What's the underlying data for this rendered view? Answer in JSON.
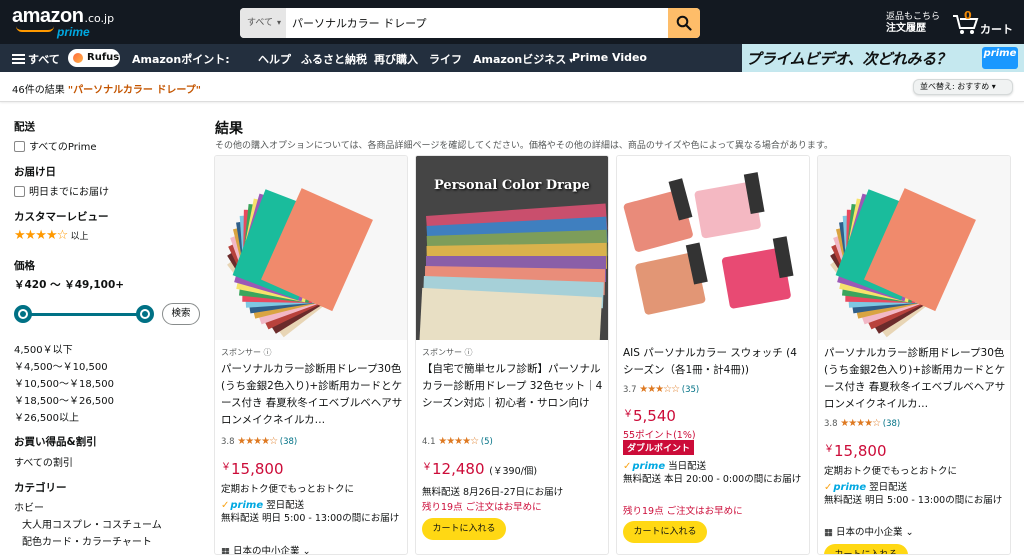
{
  "header": {
    "logo_text": "amazon",
    "logo_tld": ".co.jp",
    "logo_prime": "prime",
    "search_category": "すべて",
    "search_value": "パーソナルカラー ドレープ",
    "orders_line1": "返品もこちら",
    "orders_line2": "注文履歴",
    "cart_count": "0",
    "cart_label": "カート"
  },
  "nav": {
    "all": "すべて",
    "rufus": "Rufus",
    "items": [
      "Amazonポイント:",
      "ヘルプ",
      "ふるさと納税",
      "再び購入",
      "ライフ",
      "Amazonビジネス",
      "Prime Video"
    ],
    "promo_text": "プライムビデオ、次どれみる？",
    "promo_badge": "prime"
  },
  "results": {
    "count_text": "46件の結果",
    "query_text": "\"パーソナルカラー ドレープ\"",
    "sort_label": "並べ替え: おすすめ"
  },
  "sidebar": {
    "delivery_heading": "配送",
    "all_prime": "すべてのPrime",
    "delivery_date_heading": "お届け日",
    "tomorrow": "明日までにお届け",
    "review_heading": "カスタマーレビュー",
    "review_stars": "★★★★☆",
    "review_suffix": "以上",
    "price_heading": "価格",
    "price_range": "￥420 〜 ￥49,100+",
    "search_button": "検索",
    "price_options": [
      "4,500￥以下",
      "￥4,500〜￥10,500",
      "￥10,500〜￥18,500",
      "￥18,500〜￥26,500",
      "￥26,500以上"
    ],
    "deals_heading": "お買い得品&割引",
    "all_discounts": "すべての割引",
    "category_heading": "カテゴリー",
    "categories": [
      "ホビー",
      "大人用コスプレ・コスチューム",
      "配色カード・カラーチャート"
    ]
  },
  "main": {
    "title": "結果",
    "subtitle": "その他の購入オプションについては、各商品詳細ページを確認してください。価格やその他の詳細は、商品のサイズや色によって異なる場合があります。"
  },
  "products": [
    {
      "sponsored": "スポンサー ⓘ",
      "name": "パーソナルカラー診断用ドレープ30色(うち金銀2色入り)+診断用カードとケース付き 春夏秋冬イエベブルベヘアサロンメイクネイルカ…",
      "rating": "3.8",
      "stars": "★★★★☆",
      "reviews": "(38)",
      "price": "15,800",
      "sub_note": "定期おトク便でもっとおトクに",
      "prime_note": "翌日配送",
      "delivery": "無料配送 明日 5:00 - 13:00の間にお届け",
      "seller": "日本の中小企業"
    },
    {
      "sponsored": "スポンサー ⓘ",
      "name": "【自宅で簡単セルフ診断】パーソナルカラー診断用ドレープ 32色セット｜4シーズン対応｜初心者・サロン向け",
      "image_title": "Personal Color Drape",
      "rating": "4.1",
      "stars": "★★★★☆",
      "reviews": "(5)",
      "price": "12,480",
      "unit_price": "(￥390/個)",
      "delivery": "無料配送 8月26日-27日にお届け",
      "stock": "残り19点 ご注文はお早めに",
      "button": "カートに入れる"
    },
    {
      "name": "AIS パーソナルカラー スウォッチ (4シーズン（各1冊・計4冊))",
      "rating": "3.7",
      "stars": "★★★☆☆",
      "reviews": "(35)",
      "price": "5,540",
      "points": "55ポイント(1%)",
      "badge": "ダブルポイント",
      "prime_note": "当日配送",
      "delivery": "無料配送 本日 20:00 - 0:00の間にお届け",
      "stock": "残り19点 ご注文はお早めに",
      "button": "カートに入れる"
    },
    {
      "name": "パーソナルカラー診断用ドレープ30色(うち金銀2色入り)+診断用カードとケース付き 春夏秋冬イエベブルベヘアサロンメイクネイルカ…",
      "rating": "3.8",
      "stars": "★★★★☆",
      "reviews": "(38)",
      "price": "15,800",
      "sub_note": "定期おトク便でもっとおトクに",
      "prime_note": "翌日配送",
      "delivery": "無料配送 明日 5:00 - 13:00の間にお届け",
      "seller": "日本の中小企業",
      "button": "カートに入れる"
    }
  ]
}
